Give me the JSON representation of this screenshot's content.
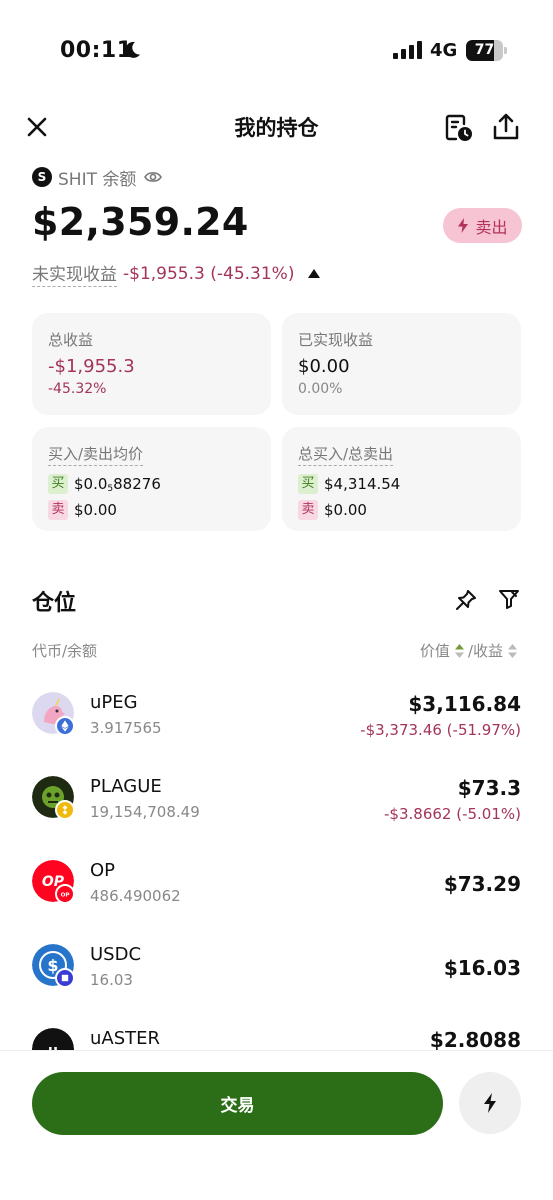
{
  "status_bar": {
    "time": "00:11",
    "network": "4G",
    "battery": "77",
    "battery_level": 0.77
  },
  "header": {
    "title": "我的持仓"
  },
  "balance": {
    "token_letter": "S",
    "label": "SHIT 余额",
    "amount": "$2,359.24",
    "sell_label": "卖出",
    "unrealized_label": "未实现收益",
    "unrealized_value": "-$1,955.3 (-45.31%)"
  },
  "cards": {
    "total_pnl": {
      "label": "总收益",
      "value": "-$1,955.3",
      "sub": "-45.32%"
    },
    "realized": {
      "label": "已实现收益",
      "value": "$0.00",
      "sub": "0.00%"
    },
    "avg_price": {
      "label": "买入/卖出均价",
      "buy_tag": "买",
      "buy_main": "$0.0",
      "buy_sub": "5",
      "buy_rest": "88276",
      "sell_tag": "卖",
      "sell_value": "$0.00"
    },
    "totals": {
      "label": "总买入/总卖出",
      "buy_tag": "买",
      "buy_value": "$4,314.54",
      "sell_tag": "卖",
      "sell_value": "$0.00"
    }
  },
  "positions": {
    "title": "仓位",
    "col_left": "代币/余额",
    "col_value": "价值",
    "col_pnl": "/收益",
    "items": [
      {
        "name": "uPEG",
        "balance": "3.917565",
        "value": "$3,116.84",
        "pnl": "-$3,373.46 (-51.97%)"
      },
      {
        "name": "PLAGUE",
        "balance": "19,154,708.49",
        "value": "$73.3",
        "pnl": "-$3.8662 (-5.01%)"
      },
      {
        "name": "OP",
        "balance": "486.490062",
        "value": "$73.29",
        "pnl": ""
      },
      {
        "name": "USDC",
        "balance": "16.03",
        "value": "$16.03",
        "pnl": ""
      },
      {
        "name": "uASTER",
        "balance": "",
        "value": "$2.8088",
        "pnl": ""
      }
    ]
  },
  "bottom": {
    "trade_label": "交易"
  },
  "colors": {
    "accent_green": "#2c6e18",
    "negative": "#a3345a",
    "sell_bg": "#f7c4d3"
  }
}
